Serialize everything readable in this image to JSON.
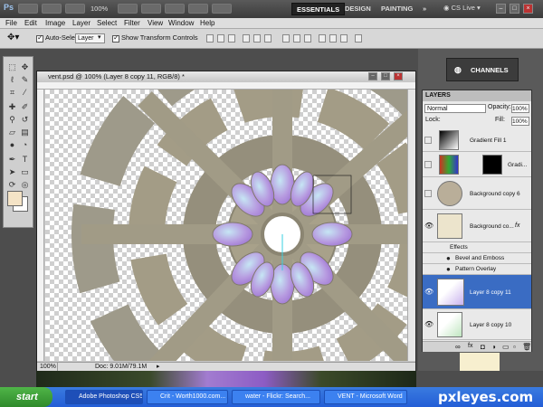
{
  "app": {
    "logo": "Ps",
    "zoom": "100%",
    "workspaces": [
      "ESSENTIALS",
      "DESIGN",
      "PAINTING"
    ],
    "more": "»",
    "cs_live": "CS Live"
  },
  "menu": [
    "File",
    "Edit",
    "Image",
    "Layer",
    "Select",
    "Filter",
    "View",
    "Window",
    "Help"
  ],
  "options": {
    "auto_select_label": "Auto-Select:",
    "auto_select_value": "Layer",
    "show_transform_label": "Show Transform Controls"
  },
  "document": {
    "title": "vent.psd @ 100% (Layer 8 copy 11, RGB/8) *",
    "zoom": "100%",
    "doc_size": "Doc: 9.01M/79.1M"
  },
  "colors": {
    "foreground": "#f4e3c6",
    "background": "#ffffff",
    "selected_layer": "#3a6cc3"
  },
  "panels": {
    "channels_tab": "CHANNELS",
    "layers_tab": "LAYERS",
    "blend_mode": "Normal",
    "opacity_label": "Opacity:",
    "opacity_value": "100%",
    "lock_label": "Lock:",
    "fill_label": "Fill:",
    "fill_value": "100%"
  },
  "layers": [
    {
      "name": "Gradient Fill 1",
      "visible": false,
      "selected": false
    },
    {
      "name": "Gradi...",
      "visible": false,
      "selected": false
    },
    {
      "name": "Background copy 6",
      "visible": false,
      "selected": false
    },
    {
      "name": "Background co...",
      "visible": true,
      "selected": false,
      "fx": "fx"
    },
    {
      "name": "Effects",
      "effect": true
    },
    {
      "name": "Bevel and Emboss",
      "effect": true
    },
    {
      "name": "Pattern Overlay",
      "effect": true
    },
    {
      "name": "Layer 8 copy 11",
      "visible": true,
      "selected": true
    },
    {
      "name": "Layer 8 copy 10",
      "visible": true,
      "selected": false
    }
  ],
  "taskbar": {
    "start": "start",
    "tasks": [
      "Adobe Photoshop CS5",
      "Crit - Worth1000.com...",
      "water - Flickr: Search...",
      "VENT - Microsoft Word"
    ],
    "watermark": "pxleyes.com"
  }
}
